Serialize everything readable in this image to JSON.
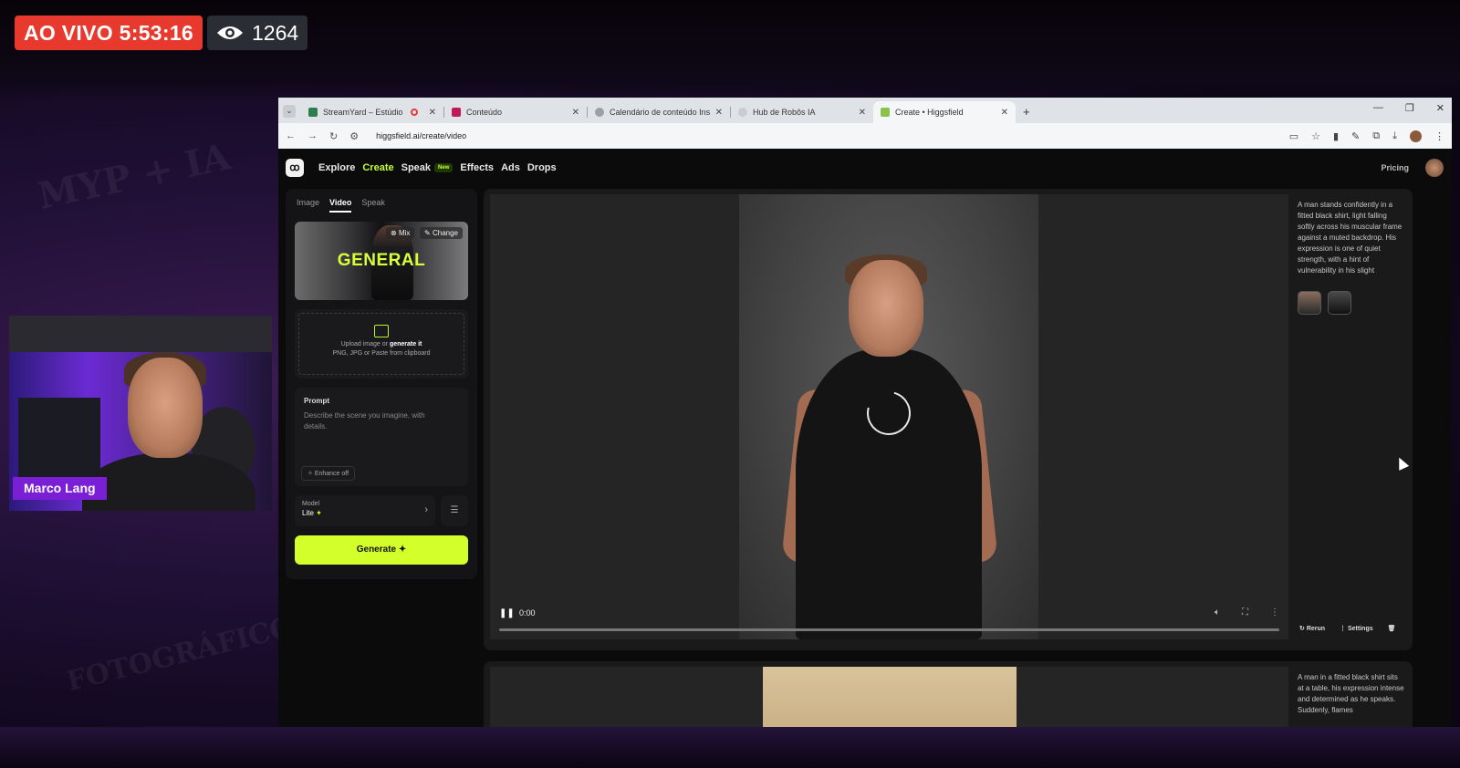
{
  "stream": {
    "live_label": "AO VIVO 5:53:16",
    "viewer_count": "1264",
    "presenter_name": "Marco Lang"
  },
  "browser": {
    "tabs": [
      {
        "label": "StreamYard – Estúdio",
        "active": false
      },
      {
        "label": "Conteúdo",
        "active": false
      },
      {
        "label": "Calendário de conteúdo Instagr",
        "active": false
      },
      {
        "label": "Hub de Robôs IA",
        "active": false
      },
      {
        "label": "Create • Higgsfield",
        "active": true
      }
    ],
    "new_tab": "+",
    "url": "higgsfield.ai/create/video"
  },
  "site": {
    "nav": {
      "explore": "Explore",
      "create": "Create",
      "speak": "Speak",
      "new_badge": "New",
      "effects": "Effects",
      "ads": "Ads",
      "drops": "Drops",
      "pricing": "Pricing"
    },
    "left_panel": {
      "subtabs": [
        "Image",
        "Video",
        "Speak"
      ],
      "preset_title": "GENERAL",
      "mix_label": "Mix",
      "change_label": "Change",
      "upload_text": "Upload image or",
      "upload_link": "generate it",
      "upload_hint": "PNG, JPG or Paste from clipboard",
      "prompt_title": "Prompt",
      "prompt_placeholder": "Describe the scene you imagine, with details.",
      "enhance_label": "Enhance off",
      "model_label": "Model",
      "model_value": "Lite",
      "generate_label": "Generate"
    },
    "result1": {
      "description": "A man stands confidently in a fitted black shirt, light falling softly across his muscular frame against a muted backdrop. His expression is one of quiet strength, with a hint of vulnerability in his slight",
      "time": "0:00",
      "playback_progress": 0.0,
      "rerun_label": "Rerun",
      "settings_label": "Settings"
    },
    "result2": {
      "description": "A man in a fitted black shirt sits at a table, his expression intense and determined as he speaks. Suddenly, flames"
    }
  },
  "colors": {
    "accent": "#d3ff2b",
    "live_red": "#e8392f",
    "name_tag": "#7a1fd6"
  }
}
